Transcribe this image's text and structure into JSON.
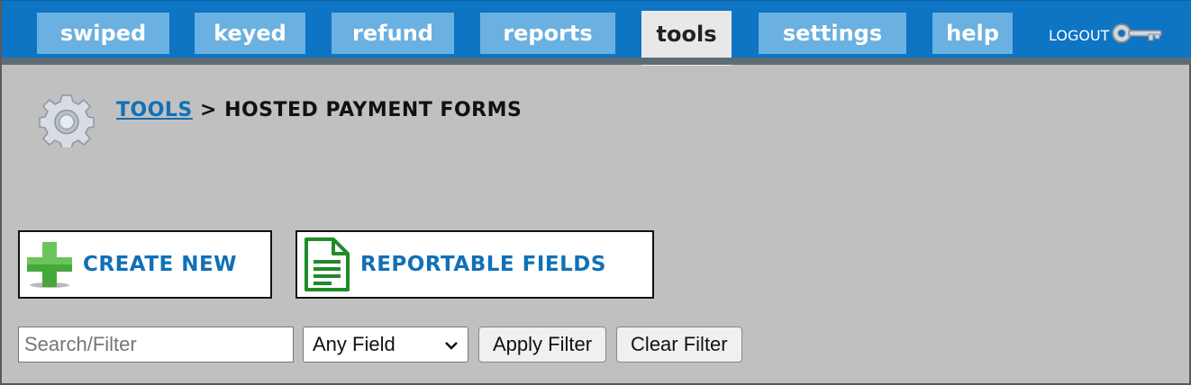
{
  "nav": {
    "tabs": [
      {
        "label": "swiped"
      },
      {
        "label": "keyed"
      },
      {
        "label": "refund"
      },
      {
        "label": "reports"
      },
      {
        "label": "tools",
        "active": true
      },
      {
        "label": "settings"
      },
      {
        "label": "help"
      }
    ],
    "logout_label": "LOGOUT",
    "logout_icon": "key-icon"
  },
  "breadcrumb": {
    "icon": "gear-icon",
    "link": "TOOLS",
    "separator": ">",
    "current": "HOSTED PAYMENT FORMS"
  },
  "actions": {
    "create_new": {
      "label": "CREATE NEW",
      "icon": "plus-icon"
    },
    "reportable_fields": {
      "label": "REPORTABLE FIELDS",
      "icon": "document-icon"
    }
  },
  "filter": {
    "search_placeholder": "Search/Filter",
    "search_value": "",
    "field_select": "Any Field",
    "apply_label": "Apply Filter",
    "clear_label": "Clear Filter"
  },
  "colors": {
    "nav_blue": "#0e74c4",
    "tab_blue": "#6ab0e0",
    "link_blue": "#1170b6",
    "background": "#c0c0c0",
    "icon_green": "#2e9b2e"
  }
}
